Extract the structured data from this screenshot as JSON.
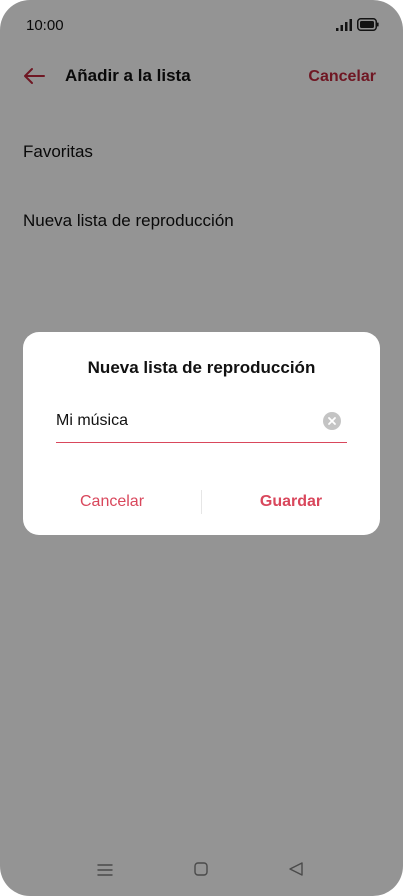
{
  "status_bar": {
    "time": "10:00",
    "icons": [
      "signal-icon",
      "battery-icon"
    ]
  },
  "header": {
    "back_icon": "arrow-left-icon",
    "title": "Añadir a la lista",
    "cancel_label": "Cancelar"
  },
  "list": {
    "items": [
      {
        "label": "Favoritas"
      },
      {
        "label": "Nueva lista de reproducción"
      }
    ]
  },
  "dialog": {
    "title": "Nueva lista de reproducción",
    "input_value": "Mi música",
    "cancel_label": "Cancelar",
    "save_label": "Guardar"
  },
  "nav_bar": {
    "icons": [
      "menu-icon",
      "home-icon",
      "back-icon"
    ]
  },
  "colors": {
    "accent": "#c0283d",
    "dialog_accent": "#d9475c",
    "overlay": "rgba(0,0,0,0.42)"
  }
}
